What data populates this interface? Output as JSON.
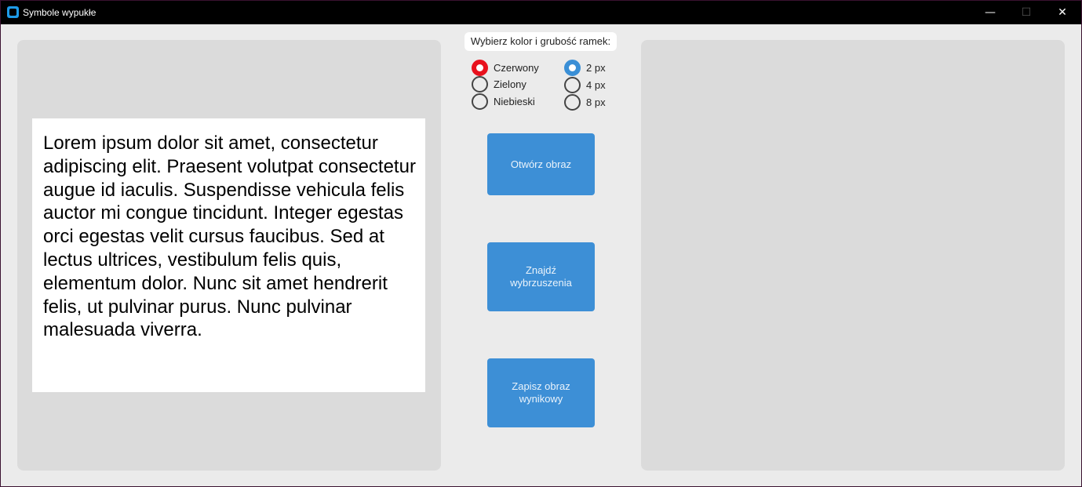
{
  "window": {
    "title": "Symbole wypukłe",
    "controls": {
      "minimize": "—",
      "maximize": "☐",
      "close": "✕"
    }
  },
  "left_panel": {
    "image_text": "Lorem ipsum dolor sit amet, consectetur adipiscing elit. Praesent volutpat consectetur augue id iaculis. Suspendisse vehicula felis auctor mi congue tincidunt. Integer egestas orci egestas velit cursus faucibus. Sed at lectus ultrices, vestibulum felis quis, elementum dolor. Nunc sit amet hendrerit felis, ut pulvinar purus. Nunc pulvinar malesuada viverra."
  },
  "options": {
    "label": "Wybierz kolor i grubość ramek:",
    "colors": [
      {
        "label": "Czerwony",
        "checked": true
      },
      {
        "label": "Zielony",
        "checked": false
      },
      {
        "label": "Niebieski",
        "checked": false
      }
    ],
    "thickness": [
      {
        "label": "2 px",
        "checked": true
      },
      {
        "label": "4 px",
        "checked": false
      },
      {
        "label": "8 px",
        "checked": false
      }
    ]
  },
  "buttons": {
    "open": "Otwórz obraz",
    "find": "Znajdź wybrzuszenia",
    "save": "Zapisz obraz wynikowy"
  },
  "colors": {
    "accent_blue": "#3d8fd6",
    "selected_red": "#e8111d",
    "panel_bg": "#dbdbdb",
    "window_bg": "#ebebeb"
  },
  "icons": {
    "app": "app-icon",
    "minimize": "minimize-icon",
    "maximize": "maximize-icon",
    "close": "close-icon"
  }
}
